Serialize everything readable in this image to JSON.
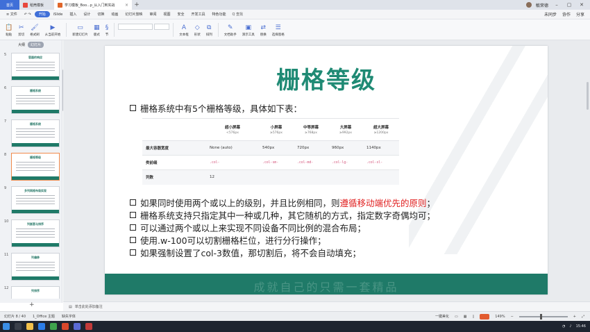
{
  "titlebar": {
    "tabs": [
      {
        "label": "首页"
      },
      {
        "label": "稻壳模板"
      },
      {
        "label": "学习模板_Boo...p_从入门到实战"
      }
    ],
    "new_tab": "+",
    "user": "敏荣德"
  },
  "menubar": {
    "file": "≡ 文件",
    "items": [
      "开始",
      "iSlide",
      "插入",
      "设计",
      "切换",
      "动画",
      "幻灯片放映",
      "审阅",
      "视图",
      "安全",
      "开发工具",
      "特色功能"
    ],
    "search": "Q 查找",
    "right": [
      "未同步",
      "协作",
      "分享"
    ]
  },
  "toolbar": {
    "tools": [
      {
        "icon": "paste-icon",
        "glyph": "📋",
        "label": "粘贴"
      },
      {
        "icon": "cut-icon",
        "glyph": "✂",
        "label": "剪切"
      },
      {
        "icon": "format-painter-icon",
        "glyph": "🖌",
        "label": "格式刷"
      },
      {
        "icon": "play-icon",
        "glyph": "▶",
        "label": "从当前开始"
      },
      {
        "icon": "new-slide-icon",
        "glyph": "▭",
        "label": "新建幻灯片"
      },
      {
        "icon": "layout-icon",
        "glyph": "▦",
        "label": "版式"
      },
      {
        "icon": "section-icon",
        "glyph": "§",
        "label": "节"
      },
      {
        "icon": "textbox-icon",
        "glyph": "A",
        "label": "文本框"
      },
      {
        "icon": "shape-icon",
        "glyph": "◇",
        "label": "形状"
      },
      {
        "icon": "arrange-icon",
        "glyph": "⧉",
        "label": "排列"
      },
      {
        "icon": "doc-assist-icon",
        "glyph": "✎",
        "label": "文档助手"
      },
      {
        "icon": "presenter-icon",
        "glyph": "▣",
        "label": "演示工具"
      },
      {
        "icon": "replace-icon",
        "glyph": "⇄",
        "label": "替换"
      },
      {
        "icon": "select-pane-icon",
        "glyph": "☰",
        "label": "选择窗格"
      }
    ]
  },
  "leftpanel": {
    "tabs": [
      "大纲",
      "幻灯片"
    ],
    "thumbs": [
      {
        "num": "5",
        "title": "容器的响应"
      },
      {
        "num": "6",
        "title": "栅格系统"
      },
      {
        "num": "7",
        "title": "栅格系统"
      },
      {
        "num": "8",
        "title": "栅格等级"
      },
      {
        "num": "9",
        "title": "多列网格布局实现"
      },
      {
        "num": "10",
        "title": "列嵌套与排序"
      },
      {
        "num": "11",
        "title": "列偏移"
      },
      {
        "num": "12",
        "title": "列排序"
      }
    ],
    "add": "+"
  },
  "slide": {
    "title": "栅格等级",
    "bullet1": "栅格系统中有5个栅格等级，具体如下表：",
    "table": {
      "headers": [
        {
          "name": "超小屏幕",
          "sub": "<576px"
        },
        {
          "name": "小屏幕",
          "sub": "≥576px"
        },
        {
          "name": "中等屏幕",
          "sub": "≥768px"
        },
        {
          "name": "大屏幕",
          "sub": "≥992px"
        },
        {
          "name": "超大屏幕",
          "sub": "≥1200px"
        }
      ],
      "rows": [
        {
          "label": "最大容器宽度",
          "cells": [
            "None (auto)",
            "540px",
            "720px",
            "960px",
            "1140px"
          ]
        },
        {
          "label": "类前缀",
          "cells": [
            ".col-",
            ".col-sm-",
            ".col-md-",
            ".col-lg-",
            ".col-xl-"
          ]
        },
        {
          "label": "列数",
          "cells": [
            "12",
            "",
            "",
            "",
            ""
          ]
        }
      ]
    },
    "bullets": [
      {
        "pre": "如果同时使用两个或以上的级别，并且比例相同，则",
        "red": "遵循移动端优先的原则",
        "post": "；"
      },
      {
        "pre": "栅格系统支持只指定其中一种或几种，其它随机的方式，指定数字奇偶均可；",
        "red": "",
        "post": ""
      },
      {
        "pre": "可以通过两个或以上来实现不同设备不同比例的混合布局；",
        "red": "",
        "post": ""
      },
      {
        "pre": "使用.w-100可以切割栅格栏位，进行分行操作；",
        "red": "",
        "post": ""
      },
      {
        "pre": "如果强制设置了col-3数值，那切割后，将不会自动填充；",
        "red": "",
        "post": ""
      }
    ],
    "band_text": "成就自己的只需一套精品"
  },
  "notes": {
    "placeholder": "单击此处添加备注"
  },
  "statusbar": {
    "slide_count": "幻灯片 8 / 40",
    "theme": "1_Office 主题",
    "missing_font": "缺失字体",
    "beautify": "一键美化",
    "zoom": "149%"
  },
  "taskbar": {
    "time": "15:46"
  }
}
